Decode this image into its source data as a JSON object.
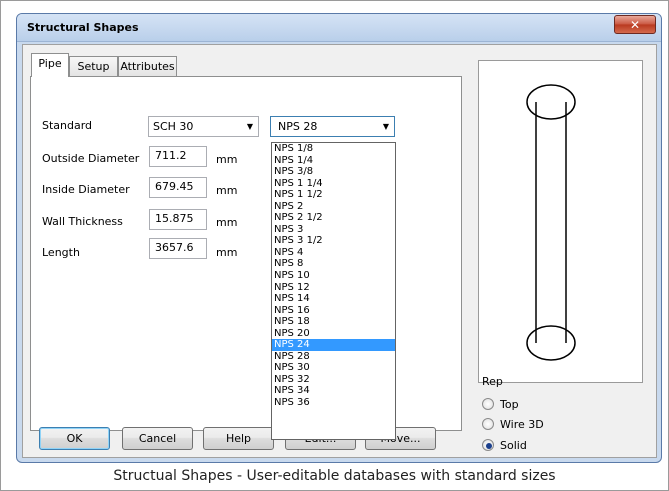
{
  "window": {
    "title": "Structural Shapes",
    "close_glyph": "✕"
  },
  "tabs": [
    {
      "label": "Pipe",
      "active": true
    },
    {
      "label": "Setup",
      "active": false
    },
    {
      "label": "Attributes",
      "active": false
    }
  ],
  "form": {
    "standard_label": "Standard",
    "standard_value": "SCH 30",
    "size_value": "NPS 28",
    "outside_diameter_label": "Outside Diameter",
    "outside_diameter_value": "711.2",
    "inside_diameter_label": "Inside Diameter",
    "inside_diameter_value": "679.45",
    "wall_thickness_label": "Wall Thickness",
    "wall_thickness_value": "15.875",
    "length_label": "Length",
    "length_value": "3657.6",
    "unit": "mm"
  },
  "size_dropdown": {
    "items": [
      "NPS 1/8",
      "NPS 1/4",
      "NPS 3/8",
      "NPS 1 1/4",
      "NPS 1 1/2",
      "NPS 2",
      "NPS 2 1/2",
      "NPS 3",
      "NPS 3 1/2",
      "NPS 4",
      "NPS 8",
      "NPS 10",
      "NPS 12",
      "NPS 14",
      "NPS 16",
      "NPS 18",
      "NPS 20",
      "NPS 24",
      "NPS 28",
      "NPS 30",
      "NPS 32",
      "NPS 34",
      "NPS 36"
    ],
    "highlighted": "NPS 24"
  },
  "buttons": {
    "ok": "OK",
    "cancel": "Cancel",
    "help": "Help",
    "edit": "Edit...",
    "move": "Move..."
  },
  "rep": {
    "label": "Rep",
    "options": [
      {
        "label": "Top",
        "selected": false
      },
      {
        "label": "Wire 3D",
        "selected": false
      },
      {
        "label": "Solid",
        "selected": true
      }
    ]
  },
  "caption": "Structual Shapes - User-editable databases with standard sizes",
  "colors": {
    "highlight": "#3399ff",
    "titlebar": "#c8d9ee",
    "close": "#c9553f"
  }
}
